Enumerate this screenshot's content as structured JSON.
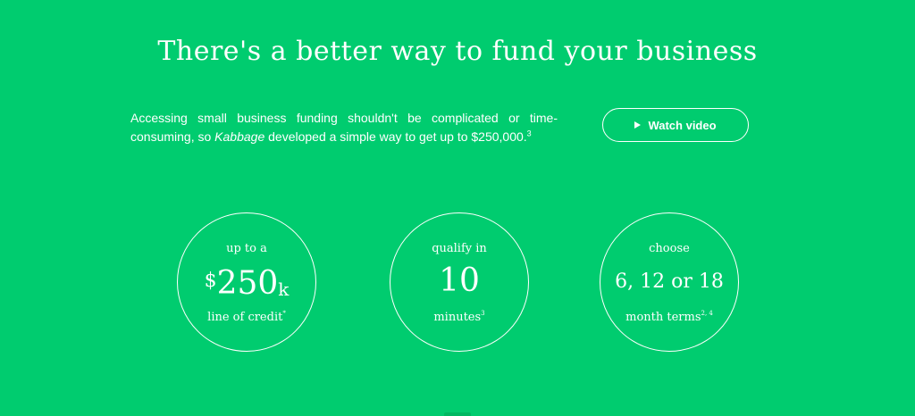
{
  "hero": {
    "title": "There's a better way to fund your business"
  },
  "intro": {
    "text_before": "Accessing small business funding shouldn't be complicated or time-consuming, so ",
    "brand": "Kabbage",
    "text_after": " developed a simple way to get up to $250,000.",
    "footnote": "3"
  },
  "watch_button": {
    "label": "Watch video",
    "icon": "play-icon"
  },
  "stats": [
    {
      "top": "up to a",
      "currency": "$",
      "value": "250",
      "suffix": "k",
      "bottom": "line of credit",
      "footnote": "*"
    },
    {
      "top": "qualify in",
      "value": "10",
      "bottom": "minutes",
      "footnote": "3"
    },
    {
      "top": "choose",
      "value": "6, 12 or 18",
      "bottom": "month terms",
      "footnote": "2, 4"
    }
  ],
  "colors": {
    "background": "#00cc6f",
    "text": "#ffffff"
  }
}
